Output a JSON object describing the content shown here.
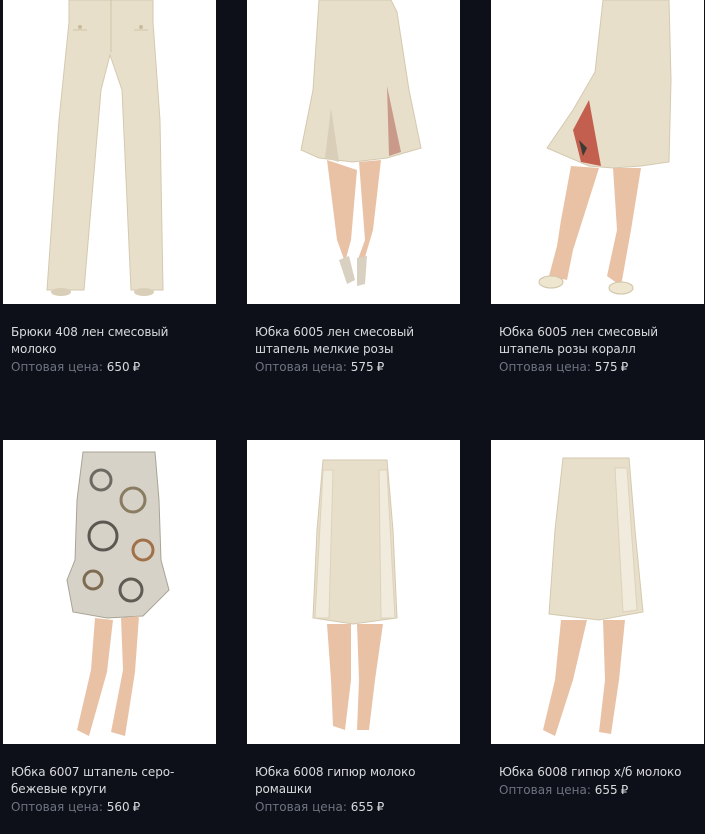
{
  "products": [
    {
      "name": "Брюки 408 лен смесовый молоко",
      "price_label": "Оптовая цена:",
      "price": "650",
      "currency": "₽",
      "image": "beige-linen-trousers-photo"
    },
    {
      "name": "Юбка 6005 лен смесовый штапель мелкие розы",
      "price_label": "Оптовая цена:",
      "price": "575",
      "currency": "₽",
      "image": "beige-flared-skirt-small-roses-photo"
    },
    {
      "name": "Юбка 6005 лен смесовый штапель розы коралл",
      "price_label": "Оптовая цена:",
      "price": "575",
      "currency": "₽",
      "image": "beige-flared-skirt-coral-roses-photo"
    },
    {
      "name": "Юбка 6007 штапель серо-бежевые круги",
      "price_label": "Оптовая цена:",
      "price": "560",
      "currency": "₽",
      "image": "grey-beige-circles-print-skirt-photo"
    },
    {
      "name": "Юбка 6008 гипюр молоко ромашки",
      "price_label": "Оптовая цена:",
      "price": "655",
      "currency": "₽",
      "image": "beige-guipure-daisy-pencil-skirt-photo"
    },
    {
      "name": "Юбка 6008 гипюр х/б молоко",
      "price_label": "Оптовая цена:",
      "price": "655",
      "currency": "₽",
      "image": "beige-cotton-guipure-pencil-skirt-photo"
    }
  ],
  "colors": {
    "background": "#0d1018",
    "text": "#d9dade",
    "muted": "#6d7380",
    "fabric": "#e6dcc6"
  }
}
